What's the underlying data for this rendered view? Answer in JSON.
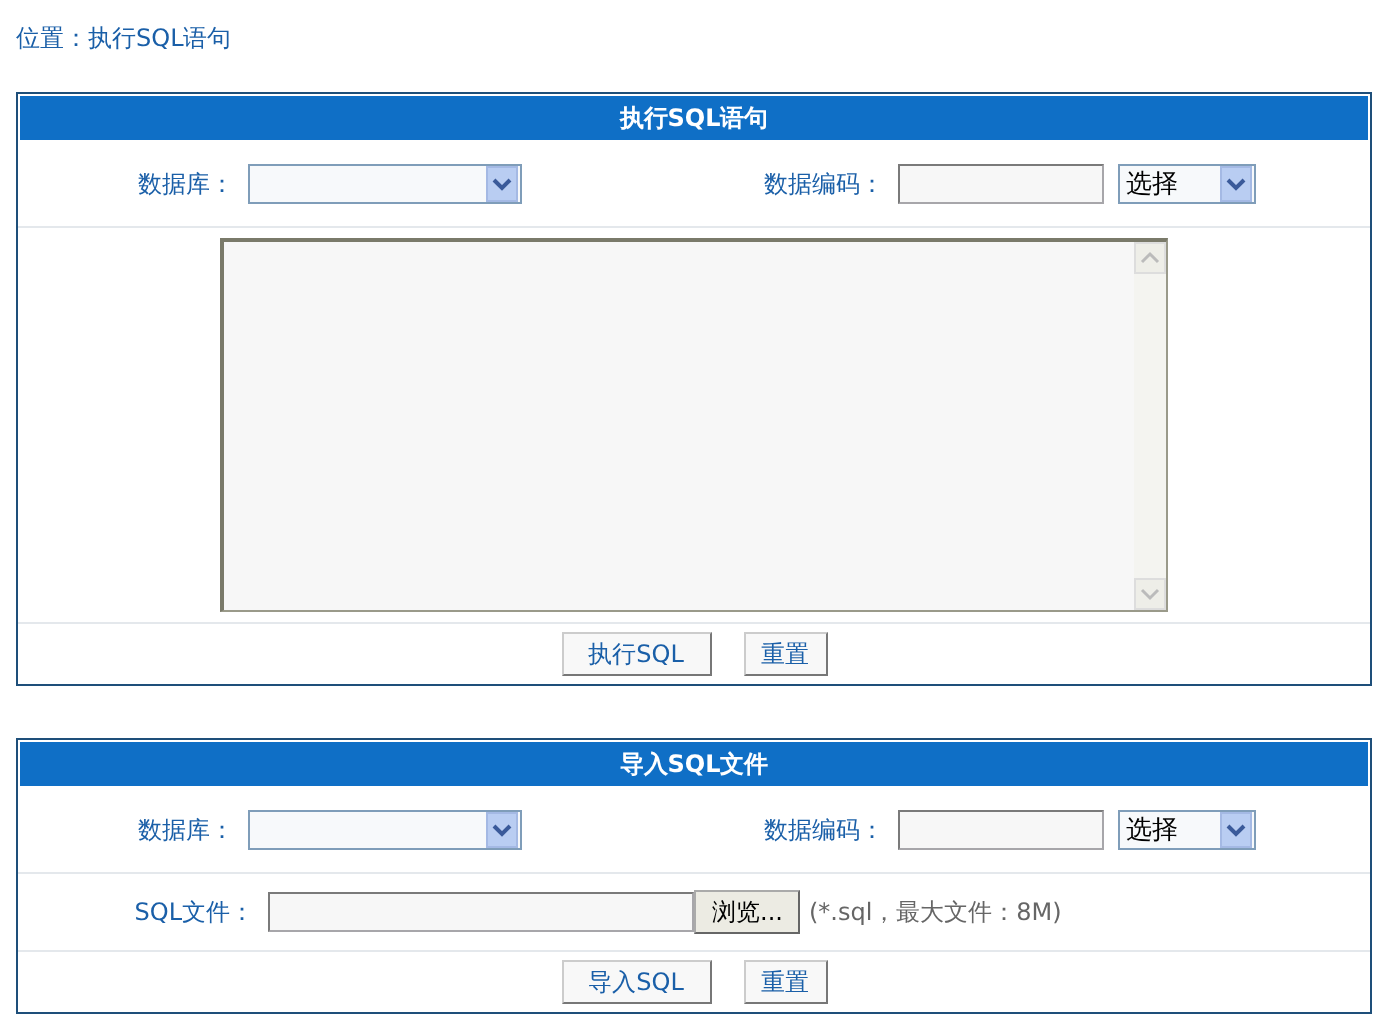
{
  "breadcrumb": "位置：执行SQL语句",
  "panels": [
    {
      "title": "执行SQL语句",
      "database_label": "数据库：",
      "encoding_label": "数据编码：",
      "encoding_select": "选择",
      "editor": {
        "kind": "textarea"
      },
      "buttons": [
        "执行SQL",
        "重置"
      ]
    },
    {
      "title": "导入SQL文件",
      "database_label": "数据库：",
      "encoding_label": "数据编码：",
      "encoding_select": "选择",
      "file": {
        "label": "SQL文件：",
        "browse": "浏览...",
        "hint": "(*.sql，最大文件：8M)"
      },
      "buttons": [
        "导入SQL",
        "重置"
      ]
    }
  ]
}
